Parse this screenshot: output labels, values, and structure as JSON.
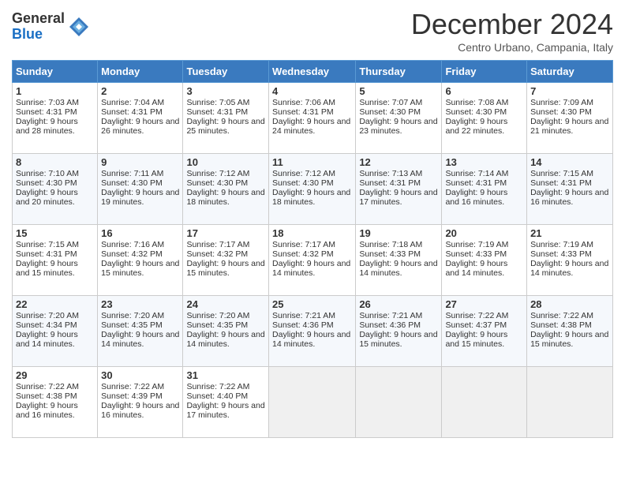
{
  "logo": {
    "general": "General",
    "blue": "Blue"
  },
  "header": {
    "title": "December 2024",
    "subtitle": "Centro Urbano, Campania, Italy"
  },
  "calendar": {
    "days_of_week": [
      "Sunday",
      "Monday",
      "Tuesday",
      "Wednesday",
      "Thursday",
      "Friday",
      "Saturday"
    ],
    "weeks": [
      [
        null,
        {
          "day": "2",
          "sunrise": "Sunrise: 7:04 AM",
          "sunset": "Sunset: 4:31 PM",
          "daylight": "Daylight: 9 hours and 26 minutes."
        },
        {
          "day": "3",
          "sunrise": "Sunrise: 7:05 AM",
          "sunset": "Sunset: 4:31 PM",
          "daylight": "Daylight: 9 hours and 25 minutes."
        },
        {
          "day": "4",
          "sunrise": "Sunrise: 7:06 AM",
          "sunset": "Sunset: 4:31 PM",
          "daylight": "Daylight: 9 hours and 24 minutes."
        },
        {
          "day": "5",
          "sunrise": "Sunrise: 7:07 AM",
          "sunset": "Sunset: 4:30 PM",
          "daylight": "Daylight: 9 hours and 23 minutes."
        },
        {
          "day": "6",
          "sunrise": "Sunrise: 7:08 AM",
          "sunset": "Sunset: 4:30 PM",
          "daylight": "Daylight: 9 hours and 22 minutes."
        },
        {
          "day": "7",
          "sunrise": "Sunrise: 7:09 AM",
          "sunset": "Sunset: 4:30 PM",
          "daylight": "Daylight: 9 hours and 21 minutes."
        }
      ],
      [
        {
          "day": "1",
          "sunrise": "Sunrise: 7:03 AM",
          "sunset": "Sunset: 4:31 PM",
          "daylight": "Daylight: 9 hours and 28 minutes."
        },
        null,
        null,
        null,
        null,
        null,
        null
      ],
      [
        {
          "day": "8",
          "sunrise": "Sunrise: 7:10 AM",
          "sunset": "Sunset: 4:30 PM",
          "daylight": "Daylight: 9 hours and 20 minutes."
        },
        {
          "day": "9",
          "sunrise": "Sunrise: 7:11 AM",
          "sunset": "Sunset: 4:30 PM",
          "daylight": "Daylight: 9 hours and 19 minutes."
        },
        {
          "day": "10",
          "sunrise": "Sunrise: 7:12 AM",
          "sunset": "Sunset: 4:30 PM",
          "daylight": "Daylight: 9 hours and 18 minutes."
        },
        {
          "day": "11",
          "sunrise": "Sunrise: 7:12 AM",
          "sunset": "Sunset: 4:30 PM",
          "daylight": "Daylight: 9 hours and 18 minutes."
        },
        {
          "day": "12",
          "sunrise": "Sunrise: 7:13 AM",
          "sunset": "Sunset: 4:31 PM",
          "daylight": "Daylight: 9 hours and 17 minutes."
        },
        {
          "day": "13",
          "sunrise": "Sunrise: 7:14 AM",
          "sunset": "Sunset: 4:31 PM",
          "daylight": "Daylight: 9 hours and 16 minutes."
        },
        {
          "day": "14",
          "sunrise": "Sunrise: 7:15 AM",
          "sunset": "Sunset: 4:31 PM",
          "daylight": "Daylight: 9 hours and 16 minutes."
        }
      ],
      [
        {
          "day": "15",
          "sunrise": "Sunrise: 7:15 AM",
          "sunset": "Sunset: 4:31 PM",
          "daylight": "Daylight: 9 hours and 15 minutes."
        },
        {
          "day": "16",
          "sunrise": "Sunrise: 7:16 AM",
          "sunset": "Sunset: 4:32 PM",
          "daylight": "Daylight: 9 hours and 15 minutes."
        },
        {
          "day": "17",
          "sunrise": "Sunrise: 7:17 AM",
          "sunset": "Sunset: 4:32 PM",
          "daylight": "Daylight: 9 hours and 15 minutes."
        },
        {
          "day": "18",
          "sunrise": "Sunrise: 7:17 AM",
          "sunset": "Sunset: 4:32 PM",
          "daylight": "Daylight: 9 hours and 14 minutes."
        },
        {
          "day": "19",
          "sunrise": "Sunrise: 7:18 AM",
          "sunset": "Sunset: 4:33 PM",
          "daylight": "Daylight: 9 hours and 14 minutes."
        },
        {
          "day": "20",
          "sunrise": "Sunrise: 7:19 AM",
          "sunset": "Sunset: 4:33 PM",
          "daylight": "Daylight: 9 hours and 14 minutes."
        },
        {
          "day": "21",
          "sunrise": "Sunrise: 7:19 AM",
          "sunset": "Sunset: 4:33 PM",
          "daylight": "Daylight: 9 hours and 14 minutes."
        }
      ],
      [
        {
          "day": "22",
          "sunrise": "Sunrise: 7:20 AM",
          "sunset": "Sunset: 4:34 PM",
          "daylight": "Daylight: 9 hours and 14 minutes."
        },
        {
          "day": "23",
          "sunrise": "Sunrise: 7:20 AM",
          "sunset": "Sunset: 4:35 PM",
          "daylight": "Daylight: 9 hours and 14 minutes."
        },
        {
          "day": "24",
          "sunrise": "Sunrise: 7:20 AM",
          "sunset": "Sunset: 4:35 PM",
          "daylight": "Daylight: 9 hours and 14 minutes."
        },
        {
          "day": "25",
          "sunrise": "Sunrise: 7:21 AM",
          "sunset": "Sunset: 4:36 PM",
          "daylight": "Daylight: 9 hours and 14 minutes."
        },
        {
          "day": "26",
          "sunrise": "Sunrise: 7:21 AM",
          "sunset": "Sunset: 4:36 PM",
          "daylight": "Daylight: 9 hours and 15 minutes."
        },
        {
          "day": "27",
          "sunrise": "Sunrise: 7:22 AM",
          "sunset": "Sunset: 4:37 PM",
          "daylight": "Daylight: 9 hours and 15 minutes."
        },
        {
          "day": "28",
          "sunrise": "Sunrise: 7:22 AM",
          "sunset": "Sunset: 4:38 PM",
          "daylight": "Daylight: 9 hours and 15 minutes."
        }
      ],
      [
        {
          "day": "29",
          "sunrise": "Sunrise: 7:22 AM",
          "sunset": "Sunset: 4:38 PM",
          "daylight": "Daylight: 9 hours and 16 minutes."
        },
        {
          "day": "30",
          "sunrise": "Sunrise: 7:22 AM",
          "sunset": "Sunset: 4:39 PM",
          "daylight": "Daylight: 9 hours and 16 minutes."
        },
        {
          "day": "31",
          "sunrise": "Sunrise: 7:22 AM",
          "sunset": "Sunset: 4:40 PM",
          "daylight": "Daylight: 9 hours and 17 minutes."
        },
        null,
        null,
        null,
        null
      ]
    ]
  }
}
